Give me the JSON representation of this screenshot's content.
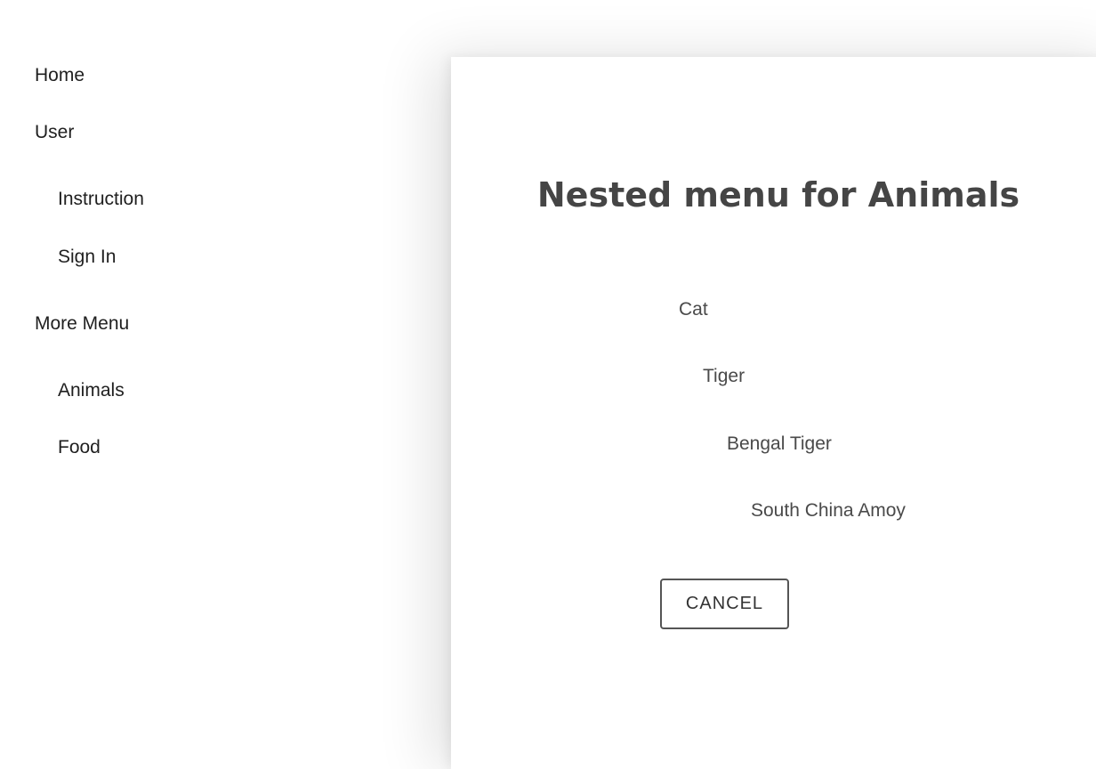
{
  "sidebar": {
    "items": [
      {
        "label": "Home"
      },
      {
        "label": "User"
      },
      {
        "label": "Instruction"
      },
      {
        "label": "Sign In"
      },
      {
        "label": "More Menu"
      },
      {
        "label": "Animals"
      },
      {
        "label": "Food"
      }
    ]
  },
  "dialog": {
    "title": "Nested menu for Animals",
    "items": [
      {
        "label": "Cat"
      },
      {
        "label": "Tiger"
      },
      {
        "label": "Bengal Tiger"
      },
      {
        "label": "South China Amoy"
      }
    ],
    "cancel_label": "CANCEL"
  }
}
